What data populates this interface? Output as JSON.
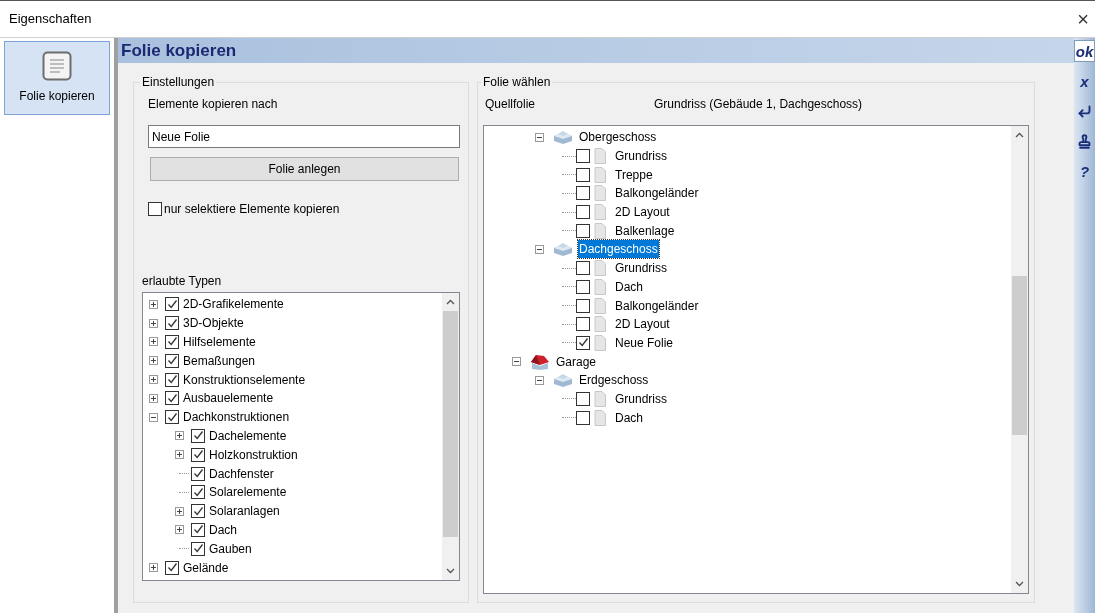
{
  "window": {
    "title": "Eigenschaften",
    "close": "×"
  },
  "sidebar": {
    "items": [
      {
        "label": "Folie kopieren",
        "selected": true
      }
    ]
  },
  "header": {
    "title": "Folie kopieren"
  },
  "toolbar": {
    "items": [
      {
        "kind": "text",
        "label": "ok",
        "selected": true
      },
      {
        "kind": "text",
        "label": "x",
        "selected": false
      },
      {
        "kind": "enter",
        "selected": false
      },
      {
        "kind": "stamp",
        "selected": false
      },
      {
        "kind": "text",
        "label": "?",
        "selected": false
      }
    ]
  },
  "settings": {
    "legend": "Einstellungen",
    "target_label": "Elemente kopieren nach",
    "target_value": "Neue Folie",
    "create_button": "Folie anlegen",
    "only_selected": {
      "label": "nur selektiere Elemente kopieren",
      "checked": false
    },
    "types_label": "erlaubte Typen",
    "types": {
      "items": [
        {
          "label": "2D-Grafikelemente",
          "kind": "branch",
          "expanded": false,
          "checked": true
        },
        {
          "label": "3D-Objekte",
          "kind": "branch",
          "expanded": false,
          "checked": true
        },
        {
          "label": "Hilfselemente",
          "kind": "branch",
          "expanded": false,
          "checked": true
        },
        {
          "label": "Bemaßungen",
          "kind": "branch",
          "expanded": false,
          "checked": true
        },
        {
          "label": "Konstruktionselemente",
          "kind": "branch",
          "expanded": false,
          "checked": true
        },
        {
          "label": "Ausbauelemente",
          "kind": "branch",
          "expanded": false,
          "checked": true
        },
        {
          "label": "Dachkonstruktionen",
          "kind": "branch",
          "expanded": true,
          "checked": true,
          "children": [
            {
              "label": "Dachelemente",
              "kind": "branch",
              "expanded": false,
              "checked": true
            },
            {
              "label": "Holzkonstruktion",
              "kind": "branch",
              "expanded": false,
              "checked": true
            },
            {
              "label": "Dachfenster",
              "kind": "leaf",
              "checked": true
            },
            {
              "label": "Solarelemente",
              "kind": "leaf",
              "checked": true
            },
            {
              "label": "Solaranlagen",
              "kind": "branch",
              "expanded": false,
              "checked": true
            },
            {
              "label": "Dach",
              "kind": "branch",
              "expanded": false,
              "checked": true
            },
            {
              "label": "Gauben",
              "kind": "leaf",
              "checked": true
            }
          ]
        },
        {
          "label": "Gelände",
          "kind": "branch",
          "expanded": false,
          "checked": true
        }
      ]
    }
  },
  "choose": {
    "legend": "Folie wählen",
    "source_label": "Quellfolie",
    "source_value": "Grundriss (Gebäude 1, Dachgeschoss)",
    "tree": {
      "items": [
        {
          "label": "Obergeschoss",
          "kind": "floor",
          "expanded": true,
          "selected": false,
          "children": [
            {
              "label": "Grundriss",
              "kind": "page",
              "checked": false
            },
            {
              "label": "Treppe",
              "kind": "page",
              "checked": false
            },
            {
              "label": "Balkongeländer",
              "kind": "page",
              "checked": false
            },
            {
              "label": "2D Layout",
              "kind": "page",
              "checked": false
            },
            {
              "label": "Balkenlage",
              "kind": "page",
              "checked": false
            }
          ]
        },
        {
          "label": "Dachgeschoss",
          "kind": "floor",
          "expanded": true,
          "selected": true,
          "children": [
            {
              "label": "Grundriss",
              "kind": "page",
              "checked": false
            },
            {
              "label": "Dach",
              "kind": "page",
              "checked": false
            },
            {
              "label": "Balkongeländer",
              "kind": "page",
              "checked": false
            },
            {
              "label": "2D Layout",
              "kind": "page",
              "checked": false
            },
            {
              "label": "Neue Folie",
              "kind": "page",
              "checked": true
            }
          ]
        },
        {
          "label": "Garage",
          "kind": "building",
          "expanded": true,
          "selected": false,
          "children": [
            {
              "label": "Erdgeschoss",
              "kind": "floor",
              "expanded": true,
              "selected": false,
              "children": [
                {
                  "label": "Grundriss",
                  "kind": "page",
                  "checked": false
                },
                {
                  "label": "Dach",
                  "kind": "page",
                  "checked": false
                }
              ]
            }
          ]
        }
      ]
    }
  }
}
